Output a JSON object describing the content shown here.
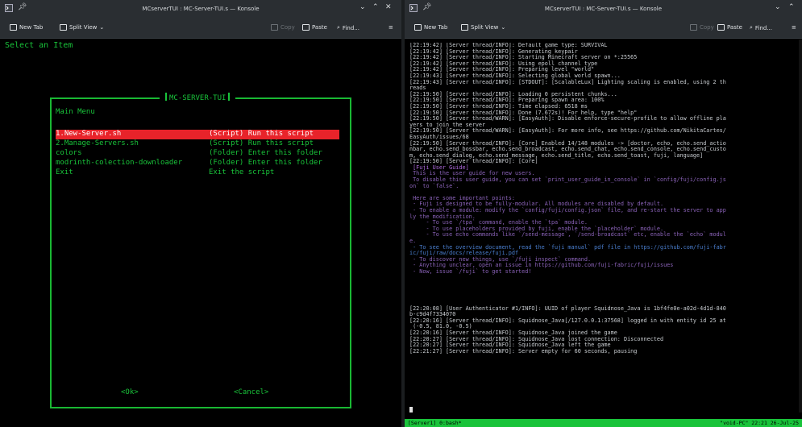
{
  "colors": {
    "terminal_bg": "#000000",
    "tui_green": "#19c33a",
    "selection_red": "#e8232a",
    "titlebar_bg": "#2a2e32",
    "guide_purple": "#8a62b8",
    "link_blue": "#4a7fd0"
  },
  "left_window": {
    "title": "MCserverTUI : MC-Server-TUI.s — Konsole",
    "toolbar": {
      "new_tab": "New Tab",
      "split_view": "Split View",
      "copy": "Copy",
      "paste": "Paste",
      "find": "Find..."
    },
    "status_line": "Select an Item",
    "dialog": {
      "title": "MC-SERVER-TUI",
      "menu_title": "Main Menu",
      "items": [
        {
          "name": "1.New-Server.sh",
          "desc": "(Script) Run this script",
          "selected": true
        },
        {
          "name": "2.Manage-Servers.sh",
          "desc": "(Script) Run this script",
          "selected": false
        },
        {
          "name": "colors",
          "desc": "(Folder) Enter this folder",
          "selected": false
        },
        {
          "name": "modrinth-colection-downloader",
          "desc": "(Folder) Enter this folder",
          "selected": false
        },
        {
          "name": "Exit",
          "desc": "Exit the script",
          "selected": false
        }
      ],
      "ok_label": "<Ok>",
      "cancel_label": "<Cancel>"
    }
  },
  "right_window": {
    "title": "MCserverTUI : MC-Server-TUI.s — Konsole",
    "toolbar": {
      "new_tab": "New Tab",
      "split_view": "Split View",
      "copy": "Copy",
      "paste": "Paste",
      "find": "Find..."
    },
    "log_lines": [
      {
        "text": "[22:19:42] [Server thread/INFO]: Default game type: SURVIVAL",
        "style": ""
      },
      {
        "text": "[22:19:42] [Server thread/INFO]: Generating keypair",
        "style": ""
      },
      {
        "text": "[22:19:42] [Server thread/INFO]: Starting Minecraft server on *:25565",
        "style": ""
      },
      {
        "text": "[22:19:42] [Server thread/INFO]: Using epoll channel type",
        "style": ""
      },
      {
        "text": "[22:19:42] [Server thread/INFO]: Preparing level \"world\"",
        "style": ""
      },
      {
        "text": "[22:19:43] [Server thread/INFO]: Selecting global world spawn...",
        "style": ""
      },
      {
        "text": "[22:19:43] [Server thread/INFO]: [STDOUT]: [ScalableLux] Lighting scaling is enabled, using 2 th",
        "style": ""
      },
      {
        "text": "reads",
        "style": ""
      },
      {
        "text": "[22:19:50] [Server thread/INFO]: Loading 0 persistent chunks...",
        "style": ""
      },
      {
        "text": "[22:19:50] [Server thread/INFO]: Preparing spawn area: 100%",
        "style": ""
      },
      {
        "text": "[22:19:50] [Server thread/INFO]: Time elapsed: 6518 ms",
        "style": ""
      },
      {
        "text": "[22:19:50] [Server thread/INFO]: Done (7.672s)! For help, type \"help\"",
        "style": ""
      },
      {
        "text": "[22:19:50] [Server thread/WARN]: [EasyAuth]: Disable enforce-secure-profile to allow offline pla",
        "style": ""
      },
      {
        "text": "yers to join the server",
        "style": ""
      },
      {
        "text": "[22:19:50] [Server thread/WARN]: [EasyAuth]: For more info, see https://github.com/NikitaCartes/",
        "style": ""
      },
      {
        "text": "EasyAuth/issues/68",
        "style": ""
      },
      {
        "text": "[22:19:50] [Server thread/INFO]: [Core] Enabled 14/148 modules -> [doctor, echo, echo.send_actio",
        "style": ""
      },
      {
        "text": "nbar, echo.send_bossbar, echo.send_broadcast, echo.send_chat, echo.send_console, echo.send_custo",
        "style": ""
      },
      {
        "text": "m, echo.send_dialog, echo.send_message, echo.send_title, echo.send_toast, fuji, language]",
        "style": ""
      },
      {
        "text": "[22:19:50] [Server thread/INFO]: [Core]",
        "style": ""
      },
      {
        "text": " [Fuji User Guide]",
        "style": "guide-t"
      },
      {
        "text": " This is the user guide for new users.",
        "style": "guide"
      },
      {
        "text": " To disable this user guide, you can set `print_user_guide_in_console` in `config/fuji/config.js",
        "style": "guide"
      },
      {
        "text": "on` to `false`.",
        "style": "guide"
      },
      {
        "text": "",
        "style": ""
      },
      {
        "text": " Here are some important points:",
        "style": "guide"
      },
      {
        "text": " - Fuji is designed to be fully-modular. All modules are disabled by default.",
        "style": "guide"
      },
      {
        "text": " - To enable a module: modify the `config/fuji/config.json` file, and re-start the server to app",
        "style": "guide"
      },
      {
        "text": "ly the modification.",
        "style": "guide"
      },
      {
        "text": "     - To use `/tpa` command, enable the `tpa` module.",
        "style": "guide"
      },
      {
        "text": "     - To use placeholders provided by fuji, enable the `placeholder` module.",
        "style": "guide"
      },
      {
        "text": "     - To use echo commands like `/send-message`, `/send-broadcast` etc, enable the `echo` modul",
        "style": "guide"
      },
      {
        "text": "e.",
        "style": "guide"
      },
      {
        "text": " - To see the overview document, read the `fuji manual` pdf file in https://github.com/fuji-fabr",
        "style": "blue"
      },
      {
        "text": "ic/fuji/raw/docs/release/fuji.pdf",
        "style": "blue"
      },
      {
        "text": " - To discover new things, use `/fuji inspect` command.",
        "style": "guide"
      },
      {
        "text": " - Anything unclear, open an issue in https://github.com/fuji-fabric/fuji/issues",
        "style": "guide"
      },
      {
        "text": " - Now, issue `/fuji` to get started!",
        "style": "guide"
      },
      {
        "text": "",
        "style": ""
      },
      {
        "text": "",
        "style": ""
      },
      {
        "text": "",
        "style": ""
      },
      {
        "text": "",
        "style": ""
      },
      {
        "text": "",
        "style": ""
      },
      {
        "text": "[22:20:08] [User Authenticator #1/INFO]: UUID of player Squidnose_Java is 1bf4fe0e-a02d-4d1d-840",
        "style": ""
      },
      {
        "text": "b-c9d4f7334070",
        "style": ""
      },
      {
        "text": "[22:20:16] [Server thread/INFO]: Squidnose_Java[/127.0.0.1:37568] logged in with entity id 25 at",
        "style": ""
      },
      {
        "text": " (-0.5, 81.0, -0.5)",
        "style": ""
      },
      {
        "text": "[22:20:16] [Server thread/INFO]: Squidnose_Java joined the game",
        "style": ""
      },
      {
        "text": "[22:20:27] [Server thread/INFO]: Squidnose_Java lost connection: Disconnected",
        "style": ""
      },
      {
        "text": "[22:20:27] [Server thread/INFO]: Squidnose_Java left the game",
        "style": ""
      },
      {
        "text": "[22:21:27] [Server thread/INFO]: Server empty for 60 seconds, pausing",
        "style": ""
      }
    ],
    "tmux_left": "[Server1] 0:bash*",
    "tmux_right": "\"void-PC\" 22:21 26-Jul-25"
  }
}
